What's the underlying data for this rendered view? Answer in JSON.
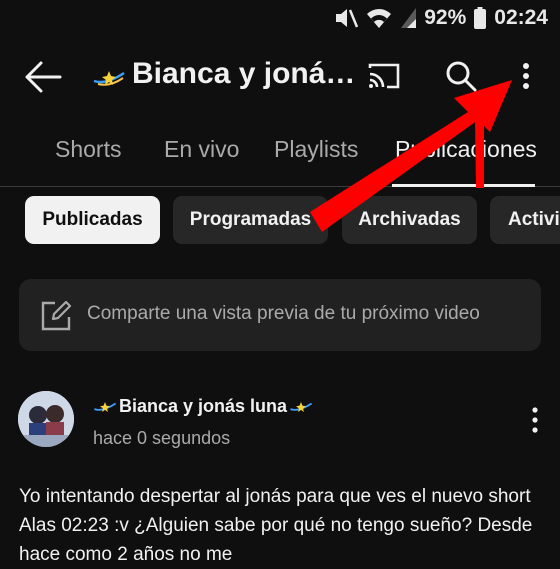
{
  "status_bar": {
    "battery": "92%",
    "time": "02:24"
  },
  "header": {
    "title": "Bianca y joná…"
  },
  "tabs": [
    {
      "label": "Shorts"
    },
    {
      "label": "En vivo"
    },
    {
      "label": "Playlists"
    },
    {
      "label": "Publicaciones"
    }
  ],
  "chips": [
    {
      "label": "Publicadas"
    },
    {
      "label": "Programadas"
    },
    {
      "label": "Archivadas"
    },
    {
      "label": "Activi"
    }
  ],
  "compose": {
    "placeholder": "Comparte una vista previa de tu próximo video"
  },
  "post": {
    "author": "Bianca y jonás luna",
    "time": "hace 0 segundos",
    "text": "Yo intentando despertar al jonás para que ves el nuevo short Alas 02:23 :v ¿Alguien sabe por qué no tengo sueño? Desde hace como 2 años no me"
  },
  "colors": {
    "background": "#0f0f0f",
    "chip_bg": "#272727",
    "overlay_arrow": "#ff0000"
  }
}
